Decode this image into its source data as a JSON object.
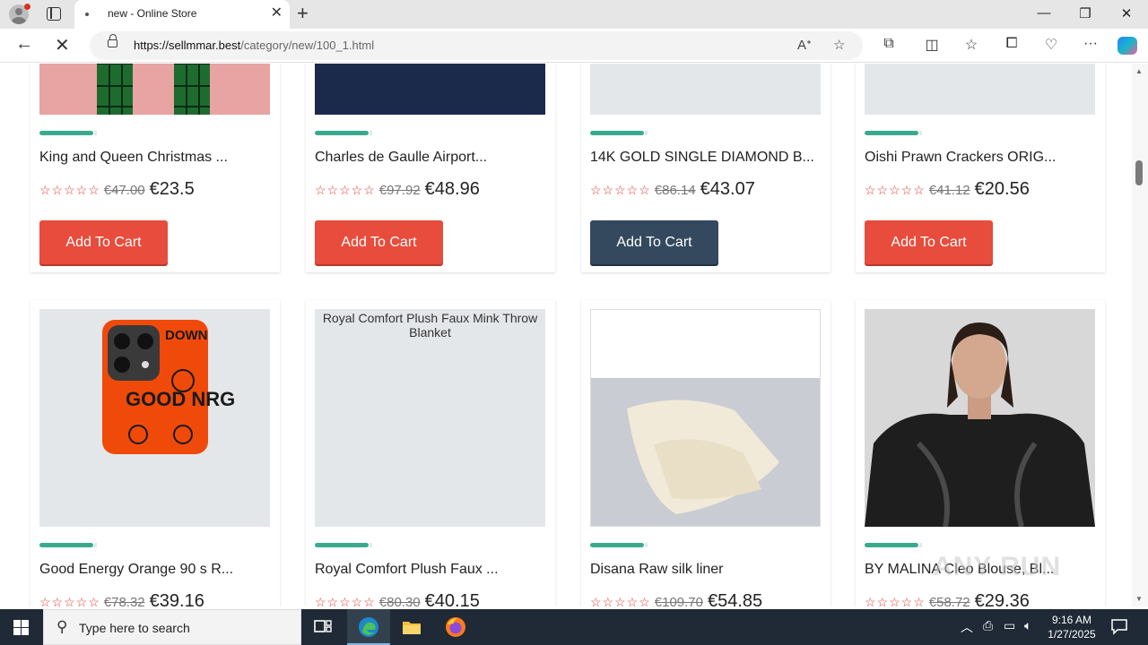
{
  "browser": {
    "tab_title": "new - Online Store",
    "new_tab": "+",
    "close_tab": "✕",
    "url_host": "https://sellmmar.best",
    "url_path": "/category/new/100_1.html"
  },
  "products_row1": [
    {
      "name": "King and Queen Christmas ...",
      "stars": "☆☆☆☆☆",
      "old_price": "€47.00",
      "price": "€23.5",
      "button": "Add To Cart"
    },
    {
      "name": "Charles de Gaulle Airport...",
      "stars": "☆☆☆☆☆",
      "old_price": "€97.92",
      "price": "€48.96",
      "button": "Add To Cart"
    },
    {
      "name": "14K GOLD SINGLE DIAMOND B...",
      "stars": "☆☆☆☆☆",
      "old_price": "€86.14",
      "price": "€43.07",
      "button": "Add To Cart"
    },
    {
      "name": "Oishi Prawn Crackers ORIG...",
      "stars": "☆☆☆☆☆",
      "old_price": "€41.12",
      "price": "€20.56",
      "button": "Add To Cart"
    }
  ],
  "products_row2": [
    {
      "name": "Good Energy Orange 90 s R...",
      "stars": "☆☆☆☆☆",
      "old_price": "€78.32",
      "price": "€39.16"
    },
    {
      "name": "Royal Comfort Plush Faux ...",
      "stars": "☆☆☆☆☆",
      "old_price": "€80.30",
      "price": "€40.15",
      "img_alt": "Royal Comfort Plush Faux Mink Throw Blanket"
    },
    {
      "name": "Disana Raw silk liner",
      "stars": "☆☆☆☆☆",
      "old_price": "€109.70",
      "price": "€54.85"
    },
    {
      "name": "BY MALINA Cleo Blouse, Bl...",
      "stars": "☆☆☆☆☆",
      "old_price": "€58.72",
      "price": "€29.36"
    }
  ],
  "phone_case_text": {
    "top": "DOWN",
    "main": "GOOD NRG"
  },
  "watermark": "ANY RUN",
  "taskbar": {
    "search_placeholder": "Type here to search",
    "time": "9:16 AM",
    "date": "1/27/2025"
  },
  "colors": {
    "accent_green": "#3aaa8f",
    "button_red": "#e74c3c",
    "button_dark": "#34495e",
    "star_red": "#e23a2c"
  }
}
